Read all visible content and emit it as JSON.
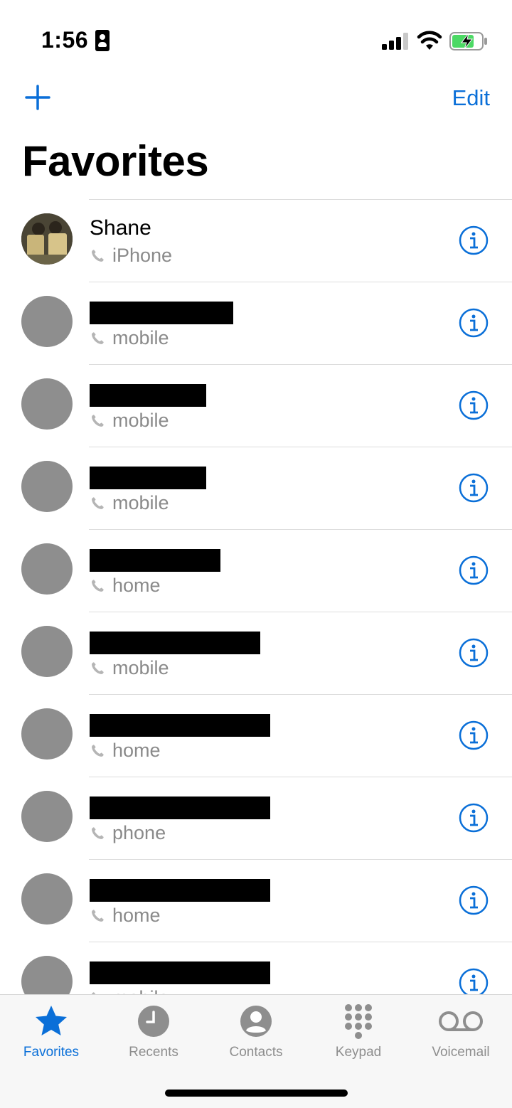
{
  "status_bar": {
    "time": "1:56"
  },
  "nav": {
    "edit_label": "Edit"
  },
  "page": {
    "title": "Favorites"
  },
  "favorites": [
    {
      "name": "Shane",
      "label": "iPhone",
      "redacted": false
    },
    {
      "name": "",
      "label": "mobile",
      "redacted": true
    },
    {
      "name": "",
      "label": "mobile",
      "redacted": true
    },
    {
      "name": "",
      "label": "mobile",
      "redacted": true
    },
    {
      "name": "",
      "label": "home",
      "redacted": true
    },
    {
      "name": "",
      "label": "mobile",
      "redacted": true
    },
    {
      "name": "",
      "label": "home",
      "redacted": true
    },
    {
      "name": "",
      "label": "phone",
      "redacted": true
    },
    {
      "name": "",
      "label": "home",
      "redacted": true
    },
    {
      "name": "",
      "label": "mobile",
      "redacted": true
    }
  ],
  "tab_bar": {
    "tabs": [
      {
        "label": "Favorites",
        "icon": "star-icon",
        "active": true
      },
      {
        "label": "Recents",
        "icon": "clock-icon",
        "active": false
      },
      {
        "label": "Contacts",
        "icon": "person-circle-icon",
        "active": false
      },
      {
        "label": "Keypad",
        "icon": "keypad-icon",
        "active": false
      },
      {
        "label": "Voicemail",
        "icon": "voicemail-icon",
        "active": false
      }
    ]
  },
  "colors": {
    "accent": "#0a6fd8",
    "secondary_text": "#8a8a8a",
    "avatar_placeholder": "#8e8e8e",
    "battery_charge": "#4cd964"
  }
}
